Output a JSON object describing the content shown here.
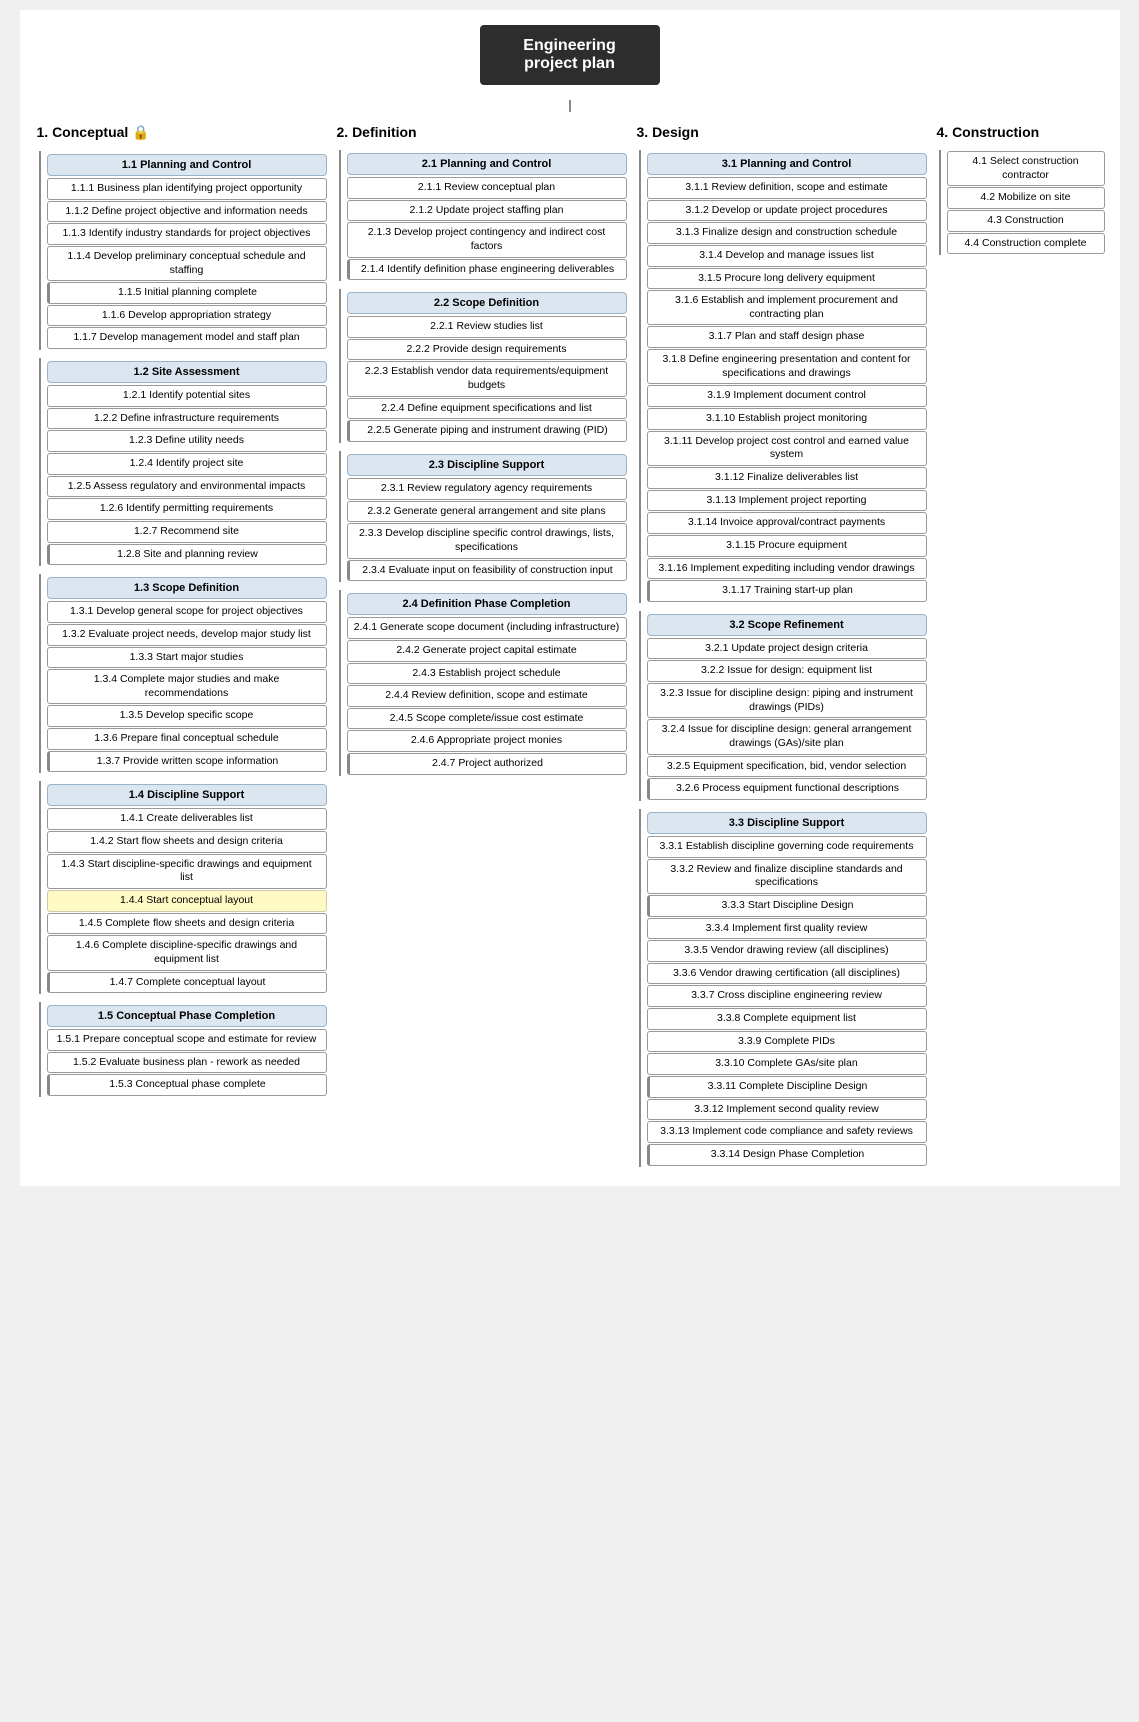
{
  "title": "Engineering\nproject plan",
  "phases": [
    {
      "id": "1",
      "label": "1.  Conceptual 🔒",
      "sections": [
        {
          "id": "1.1",
          "label": "1.1 Planning and Control",
          "items": [
            {
              "id": "1.1.1",
              "label": "Business plan identifying project opportunity"
            },
            {
              "id": "1.1.2",
              "label": "Define project objective and information needs"
            },
            {
              "id": "1.1.3",
              "label": "Identify industry standards for project objectives"
            },
            {
              "id": "1.1.4",
              "label": "Develop preliminary conceptual schedule and staffing"
            },
            {
              "id": "1.1.5",
              "label": "Initial planning complete"
            },
            {
              "id": "1.1.6",
              "label": "Develop appropriation strategy"
            },
            {
              "id": "1.1.7",
              "label": "Develop management model and staff plan"
            }
          ]
        },
        {
          "id": "1.2",
          "label": "1.2 Site Assessment",
          "items": [
            {
              "id": "1.2.1",
              "label": "Identify potential sites"
            },
            {
              "id": "1.2.2",
              "label": "Define infrastructure requirements"
            },
            {
              "id": "1.2.3",
              "label": "Define utility needs"
            },
            {
              "id": "1.2.4",
              "label": "Identify project site"
            },
            {
              "id": "1.2.5",
              "label": "Assess regulatory and environmental impacts"
            },
            {
              "id": "1.2.6",
              "label": "Identify permitting requirements"
            },
            {
              "id": "1.2.7",
              "label": "Recommend site"
            },
            {
              "id": "1.2.8",
              "label": "Site and planning review"
            }
          ]
        },
        {
          "id": "1.3",
          "label": "1.3 Scope Definition",
          "items": [
            {
              "id": "1.3.1",
              "label": "Develop general scope for project objectives"
            },
            {
              "id": "1.3.2",
              "label": "Evaluate project needs, develop major study list"
            },
            {
              "id": "1.3.3",
              "label": "Start major studies"
            },
            {
              "id": "1.3.4",
              "label": "Complete major studies and make recommendations"
            },
            {
              "id": "1.3.5",
              "label": "Develop specific scope"
            },
            {
              "id": "1.3.6",
              "label": "Prepare final conceptual schedule"
            },
            {
              "id": "1.3.7",
              "label": "Provide written scope information"
            }
          ]
        },
        {
          "id": "1.4",
          "label": "1.4 Discipline Support",
          "items": [
            {
              "id": "1.4.1",
              "label": "Create deliverables list"
            },
            {
              "id": "1.4.2",
              "label": "Start flow sheets and design criteria"
            },
            {
              "id": "1.4.3",
              "label": "Start discipline-specific drawings and equipment list"
            },
            {
              "id": "1.4.4",
              "label": "Start conceptual layout",
              "highlight": true
            },
            {
              "id": "1.4.5",
              "label": "Complete flow sheets and design criteria"
            },
            {
              "id": "1.4.6",
              "label": "Complete discipline-specific drawings and equipment list"
            },
            {
              "id": "1.4.7",
              "label": "Complete conceptual layout"
            }
          ]
        },
        {
          "id": "1.5",
          "label": "1.5 Conceptual Phase Completion",
          "items": [
            {
              "id": "1.5.1",
              "label": "Prepare conceptual scope and estimate for review"
            },
            {
              "id": "1.5.2",
              "label": "Evaluate business plan - rework as needed"
            },
            {
              "id": "1.5.3",
              "label": "Conceptual phase complete"
            }
          ]
        }
      ]
    },
    {
      "id": "2",
      "label": "2.  Definition",
      "sections": [
        {
          "id": "2.1",
          "label": "2.1 Planning and Control",
          "items": [
            {
              "id": "2.1.1",
              "label": "Review conceptual plan"
            },
            {
              "id": "2.1.2",
              "label": "Update project staffing plan"
            },
            {
              "id": "2.1.3",
              "label": "Develop project contingency and indirect cost factors"
            },
            {
              "id": "2.1.4",
              "label": "Identify definition phase engineering deliverables"
            }
          ]
        },
        {
          "id": "2.2",
          "label": "2.2 Scope Definition",
          "items": [
            {
              "id": "2.2.1",
              "label": "Review studies list"
            },
            {
              "id": "2.2.2",
              "label": "Provide design requirements"
            },
            {
              "id": "2.2.3",
              "label": "Establish vendor data requirements/equipment budgets"
            },
            {
              "id": "2.2.4",
              "label": "Define equipment specifications and list"
            },
            {
              "id": "2.2.5",
              "label": "Generate piping and instrument drawing (PID)"
            }
          ]
        },
        {
          "id": "2.3",
          "label": "2.3 Discipline Support",
          "items": [
            {
              "id": "2.3.1",
              "label": "Review regulatory agency requirements"
            },
            {
              "id": "2.3.2",
              "label": "Generate general arrangement and site plans"
            },
            {
              "id": "2.3.3",
              "label": "Develop discipline specific control drawings, lists, specifications"
            },
            {
              "id": "2.3.4",
              "label": "Evaluate input on feasibility of construction input"
            }
          ]
        },
        {
          "id": "2.4",
          "label": "2.4 Definition Phase Completion",
          "items": [
            {
              "id": "2.4.1",
              "label": "Generate scope document (including infrastructure)"
            },
            {
              "id": "2.4.2",
              "label": "Generate project capital estimate"
            },
            {
              "id": "2.4.3",
              "label": "Establish project schedule"
            },
            {
              "id": "2.4.4",
              "label": "Review definition, scope and estimate"
            },
            {
              "id": "2.4.5",
              "label": "Scope complete/issue cost estimate"
            },
            {
              "id": "2.4.6",
              "label": "Appropriate project monies"
            },
            {
              "id": "2.4.7",
              "label": "Project authorized"
            }
          ]
        }
      ]
    },
    {
      "id": "3",
      "label": "3.  Design",
      "sections": [
        {
          "id": "3.1",
          "label": "3.1 Planning and Control",
          "items": [
            {
              "id": "3.1.1",
              "label": "Review definition, scope and estimate"
            },
            {
              "id": "3.1.2",
              "label": "Develop or update project procedures"
            },
            {
              "id": "3.1.3",
              "label": "Finalize design and construction schedule"
            },
            {
              "id": "3.1.4",
              "label": "Develop and manage issues list"
            },
            {
              "id": "3.1.5",
              "label": "Procure long delivery equipment"
            },
            {
              "id": "3.1.6",
              "label": "Establish and implement procurement and contracting plan"
            },
            {
              "id": "3.1.7",
              "label": "Plan and staff design phase"
            },
            {
              "id": "3.1.8",
              "label": "Define engineering presentation and content for specifications and drawings"
            },
            {
              "id": "3.1.9",
              "label": "Implement document control"
            },
            {
              "id": "3.1.10",
              "label": "Establish project monitoring"
            },
            {
              "id": "3.1.11",
              "label": "Develop project cost control and earned value system"
            },
            {
              "id": "3.1.12",
              "label": "Finalize deliverables list"
            },
            {
              "id": "3.1.13",
              "label": "Implement project reporting"
            },
            {
              "id": "3.1.14",
              "label": "Invoice approval/contract payments"
            },
            {
              "id": "3.1.15",
              "label": "Procure equipment"
            },
            {
              "id": "3.1.16",
              "label": "Implement expediting including vendor drawings"
            },
            {
              "id": "3.1.17",
              "label": "Training start-up plan"
            }
          ]
        },
        {
          "id": "3.2",
          "label": "3.2 Scope Refinement",
          "items": [
            {
              "id": "3.2.1",
              "label": "Update project design criteria"
            },
            {
              "id": "3.2.2",
              "label": "Issue for design: equipment list"
            },
            {
              "id": "3.2.3",
              "label": "Issue for discipline design: piping and instrument drawings (PIDs)"
            },
            {
              "id": "3.2.4",
              "label": "Issue for discipline design: general arrangement drawings (GAs)/site plan"
            },
            {
              "id": "3.2.5",
              "label": "Equipment specification, bid, vendor selection"
            },
            {
              "id": "3.2.6",
              "label": "Process equipment functional descriptions"
            }
          ]
        },
        {
          "id": "3.3",
          "label": "3.3 Discipline Support",
          "items": [
            {
              "id": "3.3.1",
              "label": "Establish discipline governing code requirements"
            },
            {
              "id": "3.3.2",
              "label": "Review and finalize discipline standards and specifications"
            },
            {
              "id": "3.3.3",
              "label": "Start Discipline Design"
            },
            {
              "id": "3.3.4",
              "label": "Implement first quality review"
            },
            {
              "id": "3.3.5",
              "label": "Vendor drawing review (all disciplines)"
            },
            {
              "id": "3.3.6",
              "label": "Vendor drawing certification (all disciplines)"
            },
            {
              "id": "3.3.7",
              "label": "Cross discipline engineering review"
            },
            {
              "id": "3.3.8",
              "label": "Complete equipment list"
            },
            {
              "id": "3.3.9",
              "label": "Complete PIDs"
            },
            {
              "id": "3.3.10",
              "label": "Complete GAs/site plan"
            },
            {
              "id": "3.3.11",
              "label": "Complete Discipline Design"
            },
            {
              "id": "3.3.12",
              "label": "Implement second quality review"
            },
            {
              "id": "3.3.13",
              "label": "Implement code compliance and safety reviews"
            },
            {
              "id": "3.3.14",
              "label": "Design Phase Completion"
            }
          ]
        }
      ]
    },
    {
      "id": "4",
      "label": "4.  Construction",
      "sections": [
        {
          "id": "4-items",
          "label": null,
          "items": [
            {
              "id": "4.1",
              "label": "Select construction contractor"
            },
            {
              "id": "4.2",
              "label": "Mobilize on site"
            },
            {
              "id": "4.3",
              "label": "Construction"
            },
            {
              "id": "4.4",
              "label": "Construction complete"
            }
          ]
        }
      ]
    }
  ]
}
